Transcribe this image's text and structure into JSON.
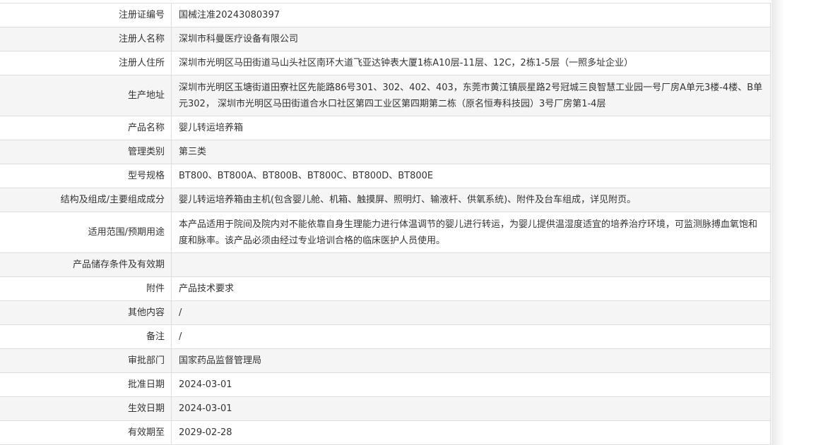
{
  "rows": [
    {
      "label": "注册证编号",
      "value": "国械注准20243080397"
    },
    {
      "label": "注册人名称",
      "value": "深圳市科曼医疗设备有限公司"
    },
    {
      "label": "注册人住所",
      "value": "深圳市光明区马田街道马山头社区南环大道飞亚达钟表大厦1栋A10层-11层、12C，2栋1-5层（一照多址企业）"
    },
    {
      "label": "生产地址",
      "value": "深圳市光明区玉塘街道田寮社区先能路86号301、302、402、403，东莞市黄江镇辰星路2号冠城三良智慧工业园一号厂房A单元3楼-4楼、B单元302， 深圳市光明区马田街道合水口社区第四工业区第四期第二栋（原名恒寿科技园）3号厂房第1-4层"
    },
    {
      "label": "产品名称",
      "value": "婴儿转运培养箱"
    },
    {
      "label": "管理类别",
      "value": "第三类"
    },
    {
      "label": "型号规格",
      "value": "BT800、BT800A、BT800B、BT800C、BT800D、BT800E"
    },
    {
      "label": "结构及组成/主要组成成分",
      "value": "婴儿转运培养箱由主机(包含婴儿舱、机箱、触摸屏、照明灯、输液杆、供氧系统)、附件及台车组成，详见附页。"
    },
    {
      "label": "适用范围/预期用途",
      "value": "本产品适用于院间及院内对不能依靠自身生理能力进行体温调节的婴儿进行转运，为婴儿提供温湿度适宜的培养治疗环境，可监测脉搏血氧饱和度和脉率。该产品必须由经过专业培训合格的临床医护人员使用。"
    },
    {
      "label": "产品储存条件及有效期",
      "value": ""
    },
    {
      "label": "附件",
      "value": "产品技术要求"
    },
    {
      "label": "其他内容",
      "value": "/"
    },
    {
      "label": "备注",
      "value": "/"
    },
    {
      "label": "审批部门",
      "value": "国家药品监督管理局"
    },
    {
      "label": "批准日期",
      "value": "2024-03-01"
    },
    {
      "label": "生效日期",
      "value": "2024-03-01"
    },
    {
      "label": "有效期至",
      "value": "2029-02-28"
    }
  ]
}
